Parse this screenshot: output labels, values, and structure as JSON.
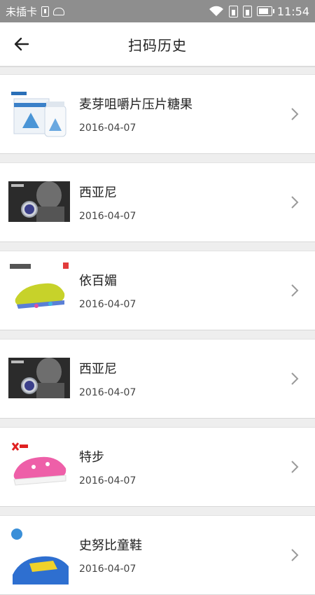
{
  "statusbar": {
    "carrier": "未插卡",
    "time": "11:54",
    "battery_level": 0.8
  },
  "header": {
    "title": "扫码历史",
    "back_icon": "arrow-left-icon"
  },
  "items": [
    {
      "title": "麦芽咀嚼片压片糖果",
      "date": "2016-04-07",
      "thumb": "supplement-bottle"
    },
    {
      "title": "西亚尼",
      "date": "2016-04-07",
      "thumb": "watch-ad"
    },
    {
      "title": "依百媚",
      "date": "2016-04-07",
      "thumb": "yellow-shoe"
    },
    {
      "title": "西亚尼",
      "date": "2016-04-07",
      "thumb": "watch-ad"
    },
    {
      "title": "特步",
      "date": "2016-04-07",
      "thumb": "pink-sneaker"
    },
    {
      "title": "史努比童鞋",
      "date": "2016-04-07",
      "thumb": "kids-shoe"
    }
  ],
  "colors": {
    "statusbar": "#8e8e8e",
    "background": "#eeeeee",
    "text": "#222222",
    "chevron": "#9a9a9a"
  }
}
